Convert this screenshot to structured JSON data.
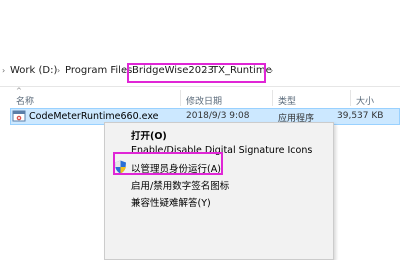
{
  "breadcrumb": {
    "items": [
      "Work (D:)",
      "Program Files",
      "BridgeWise2023",
      "TX_Runtime"
    ]
  },
  "columns": {
    "name": "名称",
    "date": "修改日期",
    "type": "类型",
    "size": "大小"
  },
  "file": {
    "name": "CodeMeterRuntime660.exe",
    "date": "2018/9/3 9:08",
    "type": "应用程序",
    "size": "39,537 KB"
  },
  "context_menu": {
    "items": [
      {
        "label": "打开(O)"
      },
      {
        "label": "Enable/Disable Digital Signature Icons"
      },
      {
        "label": "以管理员身份运行(A)"
      },
      {
        "label": "启用/禁用数字签名图标"
      },
      {
        "label": "兼容性疑难解答(Y)"
      }
    ]
  },
  "colors": {
    "highlight": "#e026d6",
    "selected_row": "#cce8ff",
    "menu_bg": "#f2f2f2"
  },
  "icons": [
    "executable-file-icon",
    "uac-shield-icon",
    "chevron-right-icon",
    "sort-up-icon"
  ]
}
